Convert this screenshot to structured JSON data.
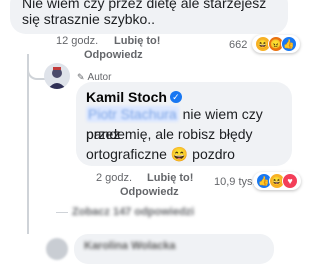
{
  "top_comment": {
    "text_line1": "Nie wiem czy przez dietę ale starzejesz",
    "text_line2": "się strasznie szybko..",
    "time": "12 godz.",
    "like": "Lubię to!",
    "reply": "Odpowiedz",
    "reaction_count": "662",
    "reactions": [
      "haha",
      "angry",
      "like"
    ]
  },
  "reply_comment": {
    "author_badge": "Autor",
    "author_name": "Kamil Stoch",
    "mention": "Piotr Stachura",
    "text_part1": "nie wiem czy przez",
    "text_part2": "pandemię, ale robisz błędy",
    "text_part3": "ortograficzne",
    "emoji": "😄",
    "text_part4": "pozdro",
    "time": "2 godz.",
    "like": "Lubię to!",
    "reply": "Odpowiedz",
    "reaction_count": "10,9 tys.",
    "reactions": [
      "like",
      "haha",
      "love"
    ]
  },
  "more_replies": "Zobacz 147 odpowiedzi",
  "next_comment_author": "Karolina Wolacka",
  "colors": {
    "bubble": "#f0f2f5",
    "muted": "#65676b",
    "link": "#1877f2",
    "like": "#1877f2",
    "haha": "#f7b125",
    "angry": "#e9710f",
    "love": "#f33e58"
  }
}
